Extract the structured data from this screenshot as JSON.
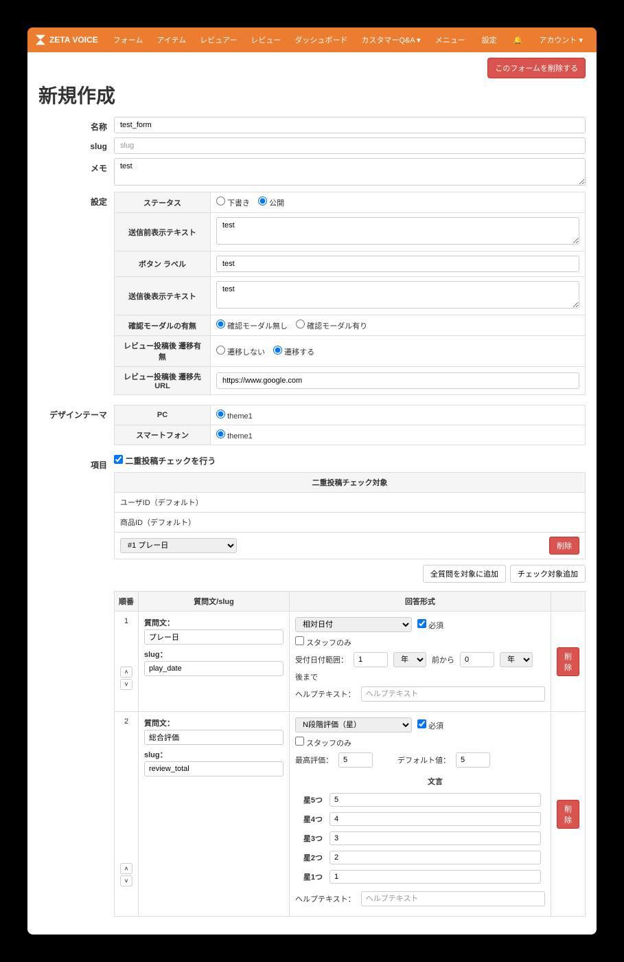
{
  "brand": "ZETA VOICE",
  "nav": {
    "form": "フォーム",
    "item": "アイテム",
    "reviewer": "レビュアー",
    "review": "レビュー",
    "dashboard": "ダッシュボード",
    "customerqa": "カスタマーQ&A",
    "menu": "メニュー",
    "settings": "設定",
    "account": "アカウント"
  },
  "delete_form_btn": "このフォームを削除する",
  "page_title": "新規作成",
  "fields": {
    "name_label": "名称",
    "name_value": "test_form",
    "slug_label": "slug",
    "slug_placeholder": "slug",
    "memo_label": "メモ",
    "memo_value": "test",
    "settings_label": "設定",
    "design_label": "デザインテーマ",
    "items_label": "項目"
  },
  "settings": {
    "status_label": "ステータス",
    "status_draft": "下書き",
    "status_public": "公開",
    "pre_text_label": "送信前表示テキスト",
    "pre_text_value": "test",
    "button_label_label": "ボタン ラベル",
    "button_label_value": "test",
    "post_text_label": "送信後表示テキスト",
    "post_text_value": "test",
    "confirm_modal_label": "確認モーダルの有無",
    "confirm_modal_no": "確認モーダル無し",
    "confirm_modal_yes": "確認モーダル有り",
    "redirect_label": "レビュー投稿後 遷移有無",
    "redirect_no": "遷移しない",
    "redirect_yes": "遷移する",
    "redirect_url_label": "レビュー投稿後 遷移先URL",
    "redirect_url_value": "https://www.google.com"
  },
  "design": {
    "pc_label": "PC",
    "sp_label": "スマートフォン",
    "theme1": "theme1"
  },
  "dup": {
    "check_label": "二重投稿チェックを行う",
    "target_header": "二重投稿チェック対象",
    "user_id": "ユーザID（デフォルト）",
    "product_id": "商品ID（デフォルト）",
    "select_value": "#1 プレー日",
    "delete": "削除",
    "add_all": "全質問を対象に追加",
    "add_check": "チェック対象追加"
  },
  "qheader": {
    "order": "順番",
    "question": "質問文/slug",
    "answer": "回答形式"
  },
  "qcommon": {
    "question_label": "質問文：",
    "slug_label": "slug：",
    "required": "必須",
    "staff_only": "スタッフのみ",
    "help_label": "ヘルプテキスト：",
    "help_placeholder": "ヘルプテキスト",
    "delete": "削除"
  },
  "q1": {
    "order": "1",
    "question_value": "プレー日",
    "slug_value": "play_date",
    "type": "相対日付",
    "range_label": "受付日付範囲：",
    "range_from": "1",
    "unit_year": "年",
    "from_label": "前から",
    "range_to": "0",
    "to_label": "後まで"
  },
  "q2": {
    "order": "2",
    "question_value": "総合評価",
    "slug_value": "review_total",
    "type": "N段階評価（星）",
    "max_label": "最高評価：",
    "max_value": "5",
    "default_label": "デフォルト値：",
    "default_value": "5",
    "wording": "文言",
    "star5_label": "星5つ",
    "star5_value": "5",
    "star4_label": "星4つ",
    "star4_value": "4",
    "star3_label": "星3つ",
    "star3_value": "3",
    "star2_label": "星2つ",
    "star2_value": "2",
    "star1_label": "星1つ",
    "star1_value": "1"
  }
}
